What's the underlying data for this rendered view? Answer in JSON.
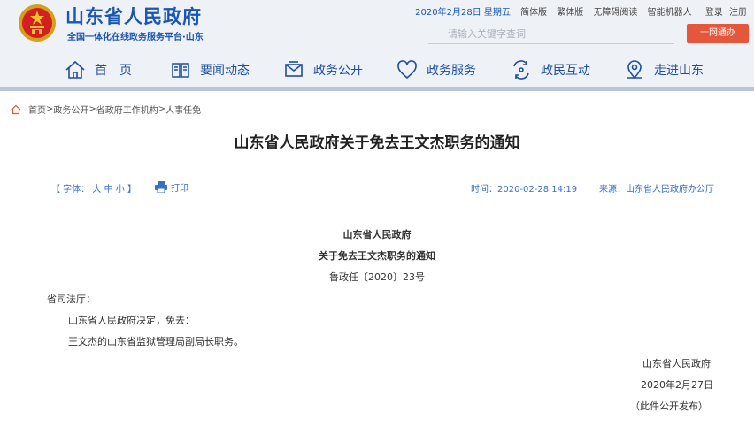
{
  "header": {
    "site_title": "山东省人民政府",
    "site_subtitle": "全国一体化在线政务服务平台·山东",
    "date": "2020年2月28日 星期五",
    "links": [
      "简体版",
      "繁体版",
      "无障碍阅读",
      "智能机器人"
    ],
    "login": "登录",
    "register": "注册",
    "search_placeholder": "请输入关键字查词",
    "ywt_button": "一网通办",
    "colors": {
      "brand_blue": "#1a56b3",
      "accent_red": "#e5563b",
      "header_bg": "#eef1f6"
    }
  },
  "nav": {
    "items": [
      {
        "label": "首　页",
        "icon": "home-icon"
      },
      {
        "label": "要闻动态",
        "icon": "news-icon"
      },
      {
        "label": "政务公开",
        "icon": "mail-icon"
      },
      {
        "label": "政务服务",
        "icon": "heart-icon"
      },
      {
        "label": "政民互动",
        "icon": "interaction-icon"
      },
      {
        "label": "走进山东",
        "icon": "location-icon"
      }
    ]
  },
  "breadcrumb": [
    "首页",
    "政务公开",
    "省政府工作机构",
    "人事任免"
  ],
  "article": {
    "title": "山东省人民政府关于免去王文杰职务的通知",
    "font_label": "【 字体：",
    "font_sizes": [
      "大",
      "中",
      "小"
    ],
    "font_close": "】",
    "print": "打印",
    "time": "时间：2020-02-28 14:19",
    "source": "来源：山东省人民政府办公厅",
    "issuer": "山东省人民政府",
    "doc_title": "关于免去王文杰职务的通知",
    "doc_number": "鲁政任〔2020〕23号",
    "recipient": "省司法厅：",
    "para1": "山东省人民政府决定，免去：",
    "para2": "王文杰的山东省监狱管理局副局长职务。",
    "signer": "山东省人民政府",
    "sign_date": "2020年2月27日",
    "note": "（此件公开发布）"
  }
}
